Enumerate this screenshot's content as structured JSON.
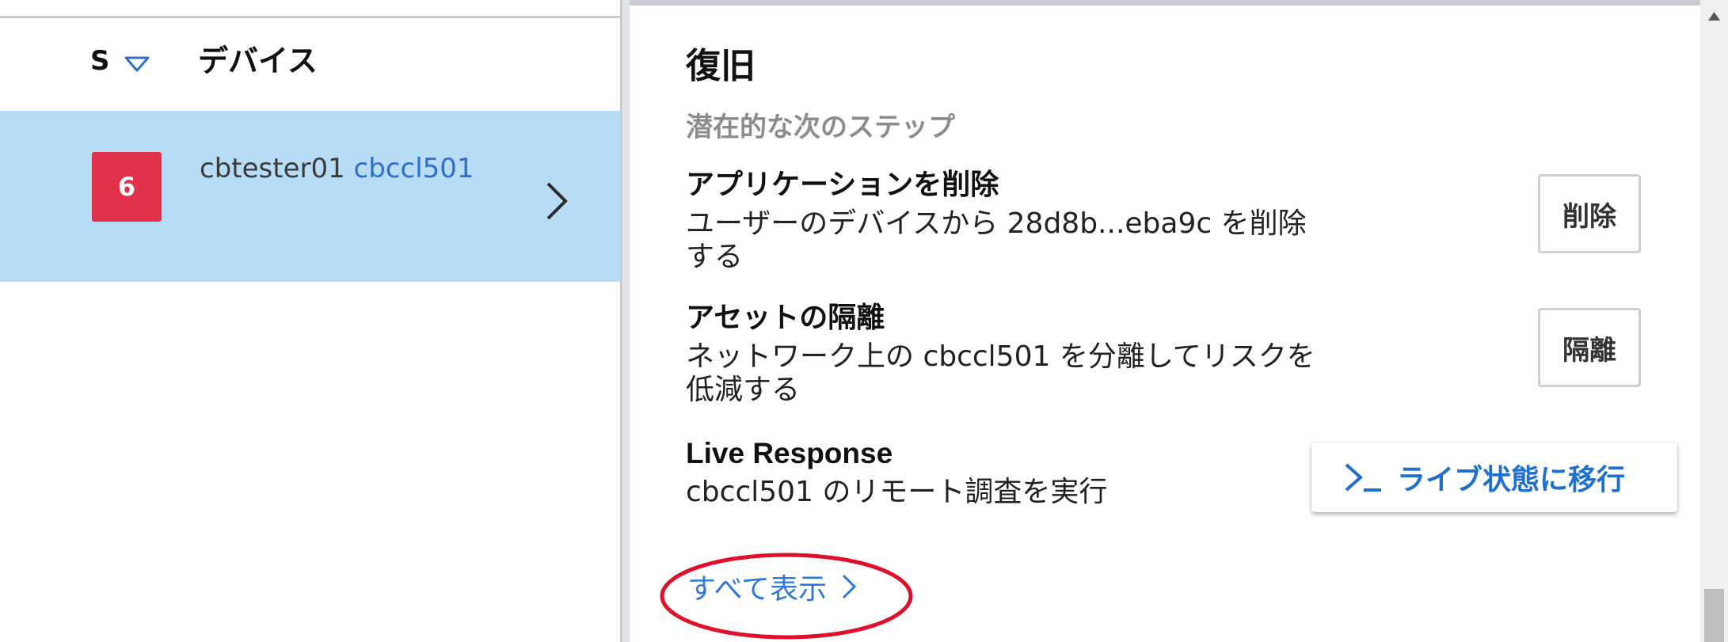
{
  "device_list": {
    "columns": {
      "severity_label": "S",
      "device_label": "デバイス"
    },
    "selected_row": {
      "severity_count": "6",
      "user": "cbtester01",
      "device": "cbccl501"
    }
  },
  "panel": {
    "title": "復旧",
    "subtitle": "潜在的な次のステップ",
    "actions": [
      {
        "title": "アプリケーションを削除",
        "description": "ユーザーのデバイスから 28d8b...eba9c を削除する",
        "button_label": "削除"
      },
      {
        "title": "アセットの隔離",
        "description": "ネットワーク上の cbccl501 を分離してリスクを低減する",
        "button_label": "隔離"
      },
      {
        "title": "Live Response",
        "description": "cbccl501 のリモート調査を実行",
        "button_label": "ライブ状態に移行",
        "button_icon": "terminal-prompt-icon"
      }
    ],
    "see_all_label": "すべて表示"
  },
  "colors": {
    "selected_row_bg": "#b6dcf6",
    "severity_badge": "#e0304a",
    "link_blue": "#2f7ad8",
    "annotation_red": "#e0102a"
  }
}
